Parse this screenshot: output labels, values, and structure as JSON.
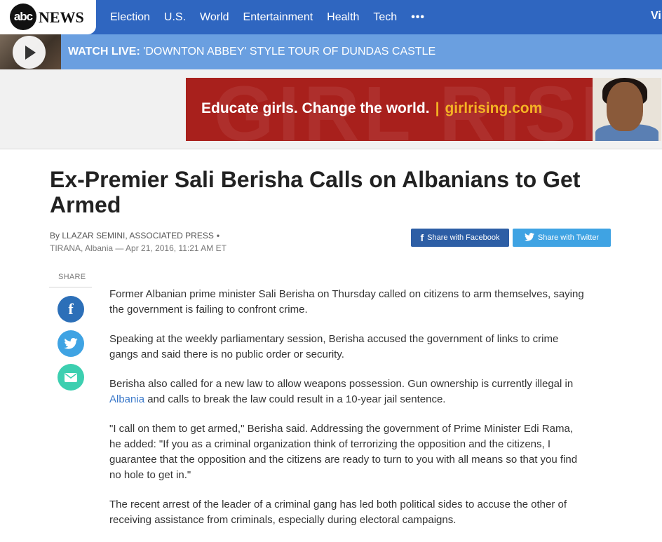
{
  "brand": {
    "logo_mark": "abc",
    "logo_word": "NEWS"
  },
  "nav": {
    "items": [
      "Election",
      "U.S.",
      "World",
      "Entertainment",
      "Health",
      "Tech"
    ],
    "more": "•••",
    "cut_item": "Vi"
  },
  "live": {
    "label": "WATCH LIVE:",
    "title": "'DOWNTON ABBEY' STYLE TOUR OF DUNDAS CASTLE"
  },
  "ad": {
    "tagline": "Educate girls. Change the world.",
    "separator": "|",
    "url": "girlrising.com",
    "watermark": "GIRL RISING",
    "background_color": "#a8201c",
    "accent_color": "#f5b324"
  },
  "article": {
    "headline": "Ex-Premier Sali Berisha Calls on Albanians to Get Armed",
    "byline": "By LLAZAR SEMINI, ASSOCIATED PRESS",
    "byline_sep": "•",
    "dateline": "TIRANA, Albania — Apr 21, 2016, 11:21 AM ET",
    "share_facebook": "Share with Facebook",
    "share_twitter": "Share with Twitter",
    "share_label": "SHARE",
    "paragraphs": [
      "Former Albanian prime minister Sali Berisha on Thursday called on citizens to arm themselves, saying the government is failing to confront crime.",
      "Speaking at the weekly parliamentary session, Berisha accused the government of links to crime gangs and said there is no public order or security.",
      {
        "before": "Berisha also called for a new law to allow weapons possession. Gun ownership is currently illegal in ",
        "link": "Albania",
        "after": " and calls to break the law could result in a 10-year jail sentence."
      },
      "\"I call on them to get armed,\" Berisha said. Addressing the government of Prime Minister Edi Rama, he added: \"If you as a criminal organization think of terrorizing the opposition and the citizens, I guarantee that the opposition and the citizens are ready to turn to you with all means so that you find no hole to get in.\"",
      "The recent arrest of the leader of a criminal gang has led both political sides to accuse the other of receiving assistance from criminals, especially during electoral campaigns."
    ]
  },
  "colors": {
    "nav_bg": "#2f66c0",
    "live_bg": "#6a9fe0",
    "facebook": "#2d5ea5",
    "twitter": "#3fa3e3",
    "email": "#3ccfb0",
    "link": "#3a78c9"
  }
}
